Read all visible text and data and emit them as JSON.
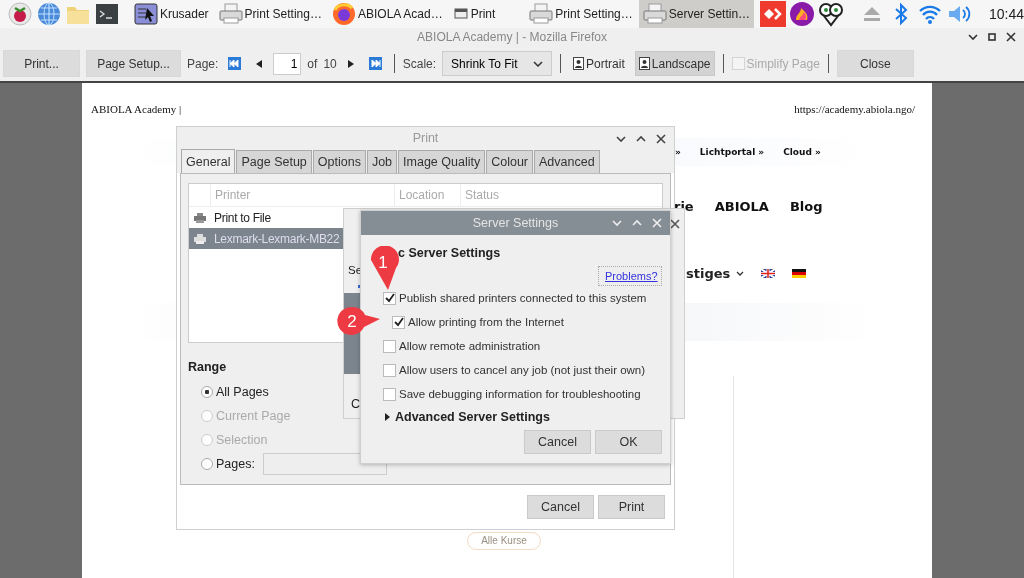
{
  "taskbar": {
    "launchers": [
      {
        "kind": "menu"
      },
      {
        "kind": "browser"
      },
      {
        "kind": "files"
      },
      {
        "kind": "terminal"
      }
    ],
    "tasks": [
      {
        "label": "Krusader",
        "kind": "filemanager",
        "selected": false
      },
      {
        "label": "Print Setting…",
        "kind": "printer",
        "selected": false
      },
      {
        "label": "ABIOLA Acad…",
        "kind": "firefox",
        "selected": false
      },
      {
        "label": "Print",
        "kind": "window",
        "selected": false
      },
      {
        "label": "Print Setting…",
        "kind": "printer",
        "selected": false
      },
      {
        "label": "Server Settin…",
        "kind": "printer",
        "selected": true
      }
    ],
    "tray": [
      {
        "kind": "remote"
      },
      {
        "kind": "flame"
      },
      {
        "kind": "owl"
      },
      {
        "kind": "eject"
      },
      {
        "kind": "bluetooth"
      },
      {
        "kind": "wifi"
      },
      {
        "kind": "volume"
      }
    ],
    "clock": "10:44"
  },
  "window": {
    "title": "ABIOLA Academy | - Mozilla Firefox"
  },
  "toolbar": {
    "print": "Print...",
    "page_setup": "Page Setup...",
    "page_label": "Page:",
    "page_value": "1",
    "of": "of",
    "page_count": "10",
    "scale_label": "Scale:",
    "scale_value": "Shrink To Fit",
    "orientation": [
      {
        "label": "Portrait",
        "selected": false
      },
      {
        "label": "Landscape",
        "selected": true
      }
    ],
    "simplify": {
      "label": "Simplify Page",
      "checked": false,
      "disabled": true
    },
    "close": "Close"
  },
  "page": {
    "header_left": "ABIOLA Academy |",
    "header_right": "https://academy.abiola.ngo/",
    "top_nav": [
      "»",
      "Lichtportal »",
      "Cloud »"
    ],
    "menu": [
      "rie",
      "ABIOLA",
      "Blog"
    ],
    "menu_2": "stiges",
    "button": "Alle Kurse"
  },
  "print_dialog": {
    "title": "Print",
    "tabs": [
      {
        "label": "General",
        "selected": true
      },
      {
        "label": "Page Setup",
        "selected": false
      },
      {
        "label": "Options",
        "selected": false
      },
      {
        "label": "Job",
        "selected": false
      },
      {
        "label": "Image Quality",
        "selected": false
      },
      {
        "label": "Colour",
        "selected": false
      },
      {
        "label": "Advanced",
        "selected": false
      }
    ],
    "columns": [
      "Printer",
      "Location",
      "Status"
    ],
    "printers": [
      {
        "name": "Print to File",
        "selected": false
      },
      {
        "name": "Lexmark-Lexmark-MB22",
        "selected": true
      }
    ],
    "range_title": "Range",
    "ranges": [
      {
        "label": "All Pages",
        "selected": true,
        "disabled": false
      },
      {
        "label": "Current Page",
        "selected": false,
        "disabled": true
      },
      {
        "label": "Selection",
        "selected": false,
        "disabled": true
      },
      {
        "label": "Pages:",
        "selected": false,
        "disabled": false
      }
    ],
    "buttons": [
      "Cancel",
      "Print"
    ]
  },
  "back_dialog": {
    "text_1": "Se",
    "text_2": "C"
  },
  "server_settings": {
    "title": "Server Settings",
    "heading": "c Server Settings",
    "problems": "Problems?",
    "options": [
      {
        "label": "Publish shared printers connected to this system",
        "checked": true,
        "indented": false
      },
      {
        "label": "Allow printing from the Internet",
        "checked": true,
        "indented": true
      },
      {
        "label": "Allow remote administration",
        "checked": false,
        "indented": false
      },
      {
        "label": "Allow users to cancel any job (not just their own)",
        "checked": false,
        "indented": false
      },
      {
        "label": "Save debugging information for troubleshooting",
        "checked": false,
        "indented": false
      }
    ],
    "advanced": {
      "label": "Advanced Server Settings",
      "expanded": false
    },
    "buttons": [
      "Cancel",
      "OK"
    ]
  },
  "annotations": [
    {
      "label": "1",
      "kind": "pin-down"
    },
    {
      "label": "2",
      "kind": "pin-right"
    }
  ]
}
